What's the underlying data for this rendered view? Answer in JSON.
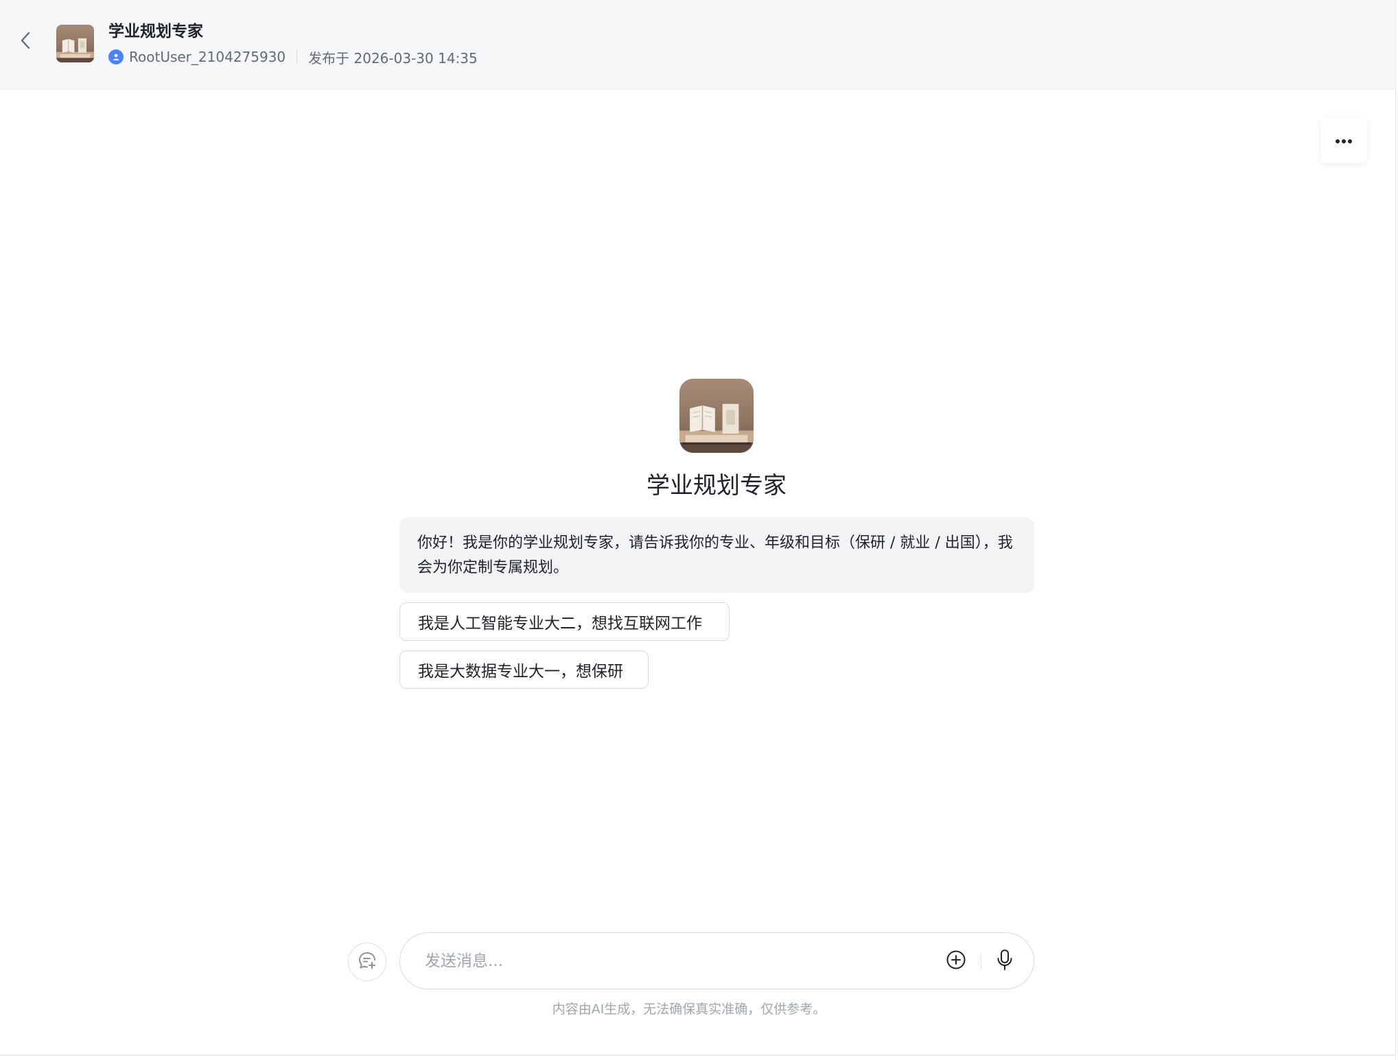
{
  "header": {
    "title": "学业规划专家",
    "author": "RootUser_2104275930",
    "published": "发布于 2026-03-30 14:35",
    "back_icon": "chevron-left-icon",
    "user_icon": "user-icon"
  },
  "toolbar": {
    "more_icon": "more-horizontal-icon"
  },
  "agent": {
    "name": "学业规划专家",
    "greeting": "你好！我是你的学业规划专家，请告诉我你的专业、年级和目标（保研 / 就业 / 出国），我会为你定制专属规划。"
  },
  "suggestions": [
    "我是人工智能专业大二，想找互联网工作",
    "我是大数据专业大一，想保研"
  ],
  "composer": {
    "value": "",
    "placeholder": "发送消息...",
    "new_chat_icon": "new-chat-icon",
    "attach_icon": "plus-circle-icon",
    "mic_icon": "microphone-icon",
    "disclaimer": "内容由AI生成，无法确保真实准确，仅供参考。"
  },
  "colors": {
    "accent": "#4e83fd",
    "header_bg": "#f6f7f9",
    "bubble_bg": "#f2f3f5",
    "text": "#1f2329",
    "muted": "#a0a6ae"
  }
}
